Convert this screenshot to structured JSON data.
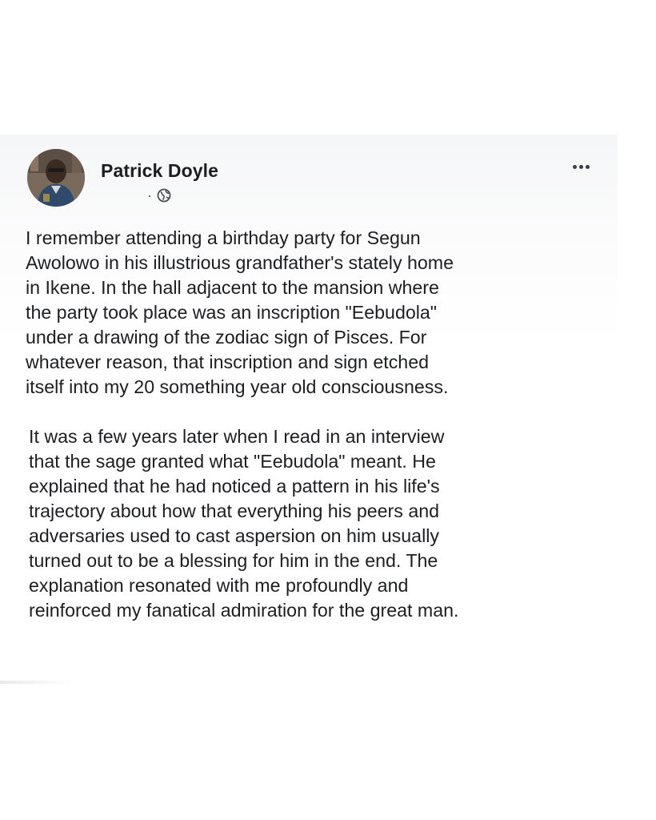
{
  "post": {
    "author": {
      "name": "Patrick Doyle",
      "avatar_icon": "profile-photo",
      "visibility_icon": "globe-icon",
      "meta_separator": "·"
    },
    "more_icon": "more-horizontal-icon",
    "paragraphs": [
      {
        "lines": [
          "I remember attending a birthday party for Segun",
          "Awolowo in his illustrious grandfather's stately home",
          "in Ikene. In the hall adjacent to the mansion where",
          "the party took place was an inscription \"Eebudola\"",
          "under a drawing of the zodiac sign of Pisces. For",
          "whatever reason, that inscription and sign etched",
          "itself into my 20 something year old consciousness."
        ]
      },
      {
        "lines": [
          "It was a few years later when I read in an interview",
          "that the sage granted what \"Eebudola\" meant. He",
          "explained that he had noticed a pattern in his life's",
          "trajectory about how that everything his peers and",
          "adversaries  used to cast aspersion on him usually",
          "turned out to be a blessing for him in the end. The",
          "explanation resonated with me profoundly and",
          "reinforced my fanatical admiration for the great man."
        ]
      }
    ]
  },
  "colors": {
    "text": "#1c1e21",
    "meta": "#4b4f56",
    "header_bg": "#f5f6f7",
    "page_bg": "#ffffff"
  }
}
